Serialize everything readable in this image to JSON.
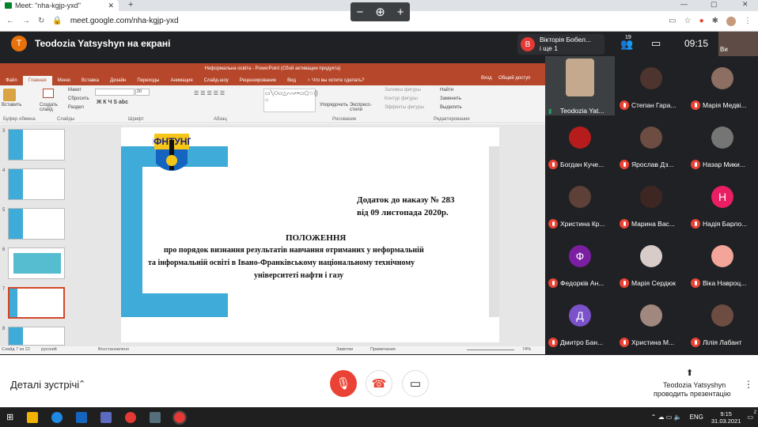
{
  "browser": {
    "tab_title": "Meet: \"nha-kgjp-yxd\"",
    "url": "meet.google.com/nha-kgjp-yxd",
    "zoom_minus": "−",
    "zoom_plus": "+"
  },
  "meet": {
    "presenter_initial": "T",
    "presenter_banner": "Teodozia Yatsyshyn на екрані",
    "top_user_initial": "В",
    "top_user_name_line1": "Вікторія Бобел...",
    "top_user_name_line2": "і ще 1",
    "people_count": "19",
    "time": "09:15",
    "self_label": "Ви"
  },
  "powerpoint": {
    "window_title": "Неформальна освіта - PowerPoint (Сбой активации продукта)",
    "tabs": [
      "Файл",
      "Главная",
      "Меню",
      "Вставка",
      "Дизайн",
      "Переходы",
      "Анимация",
      "Слайд-шоу",
      "Рецензирование",
      "Вид",
      "♀ Что вы хотите сделать?"
    ],
    "tabs_right": [
      "Вход",
      "Общий доступ"
    ],
    "ribbon": {
      "paste": "Вставить",
      "create": "Создать слайд",
      "layout": "Макет",
      "reset": "Сбросить",
      "section": "Раздел",
      "font_size": "20",
      "arrange": "Упорядочить",
      "express": "Экспресс-стили",
      "fill": "Заливка фигуры",
      "outline": "Контур фигуры",
      "effects": "Эффекты фигуры",
      "find": "Найти",
      "replace": "Заменить",
      "select": "Выделить",
      "grp_clipboard": "Буфер обмена",
      "grp_slides": "Слайды",
      "grp_font": "Шрифт",
      "grp_paragraph": "Абзац",
      "grp_drawing": "Рисование",
      "grp_editing": "Редактирование"
    },
    "thumb_numbers": [
      "3",
      "4",
      "5",
      "6",
      "7",
      "8"
    ],
    "slide": {
      "addendum_line1": "Додаток до наказу № 283",
      "addendum_line2": "від 09 листопада  2020р.",
      "heading": "ПОЛОЖЕННЯ",
      "body_line1": "про порядок визнання результатів навчання отриманих у неформальній",
      "body_line2": "та інформальній освіті  в Івано-Франківському національному технічному",
      "body_line3": "університеті нафти і газу"
    },
    "status": {
      "slide_of": "Слайд 7 из 22",
      "lang": "русский",
      "recovered": "Восстановлено",
      "notes": "Заметки",
      "comments": "Примечания",
      "zoom": "74%"
    }
  },
  "participants": [
    {
      "name": "Teodozia Yat...",
      "initial": "",
      "color": "",
      "mic": "on"
    },
    {
      "name": "Степан Гара...",
      "initial": "",
      "color": "",
      "mic": "off"
    },
    {
      "name": "Марія Медві...",
      "initial": "",
      "color": "",
      "mic": "off"
    },
    {
      "name": "Богдан Куче...",
      "initial": "",
      "color": "",
      "mic": "off"
    },
    {
      "name": "Ярослав Дз...",
      "initial": "",
      "color": "",
      "mic": "off"
    },
    {
      "name": "Назар Мики...",
      "initial": "",
      "color": "",
      "mic": "off"
    },
    {
      "name": "Христина Кр...",
      "initial": "",
      "color": "",
      "mic": "off"
    },
    {
      "name": "Марина Вас...",
      "initial": "",
      "color": "",
      "mic": "off"
    },
    {
      "name": "Надія Барло...",
      "initial": "Н",
      "color": "#e91e63",
      "mic": "off"
    },
    {
      "name": "Федорків Ан...",
      "initial": "Ф",
      "color": "#7b1fa2",
      "mic": "off"
    },
    {
      "name": "Марія Сердюк",
      "initial": "",
      "color": "",
      "mic": "off"
    },
    {
      "name": "Віка Навроц...",
      "initial": "",
      "color": "#f4a59a",
      "mic": "off"
    },
    {
      "name": "Дмитро Бан...",
      "initial": "Д",
      "color": "#7b52c9",
      "mic": "off"
    },
    {
      "name": "Христина М...",
      "initial": "",
      "color": "",
      "mic": "off"
    },
    {
      "name": "Лілія Лабант",
      "initial": "",
      "color": "",
      "mic": "off"
    }
  ],
  "bottom": {
    "details": "Деталі зустрічі",
    "presenter_line1": "Teodozia Yatsyshyn",
    "presenter_line2": "проводить презентацію"
  },
  "taskbar": {
    "lang": "ENG",
    "time": "9:15",
    "date": "31.03.2021",
    "badge": "2"
  },
  "colors": {
    "accent_blue": "#3eabd8",
    "ppt_red": "#b7472a",
    "meet_red": "#ea4335"
  }
}
